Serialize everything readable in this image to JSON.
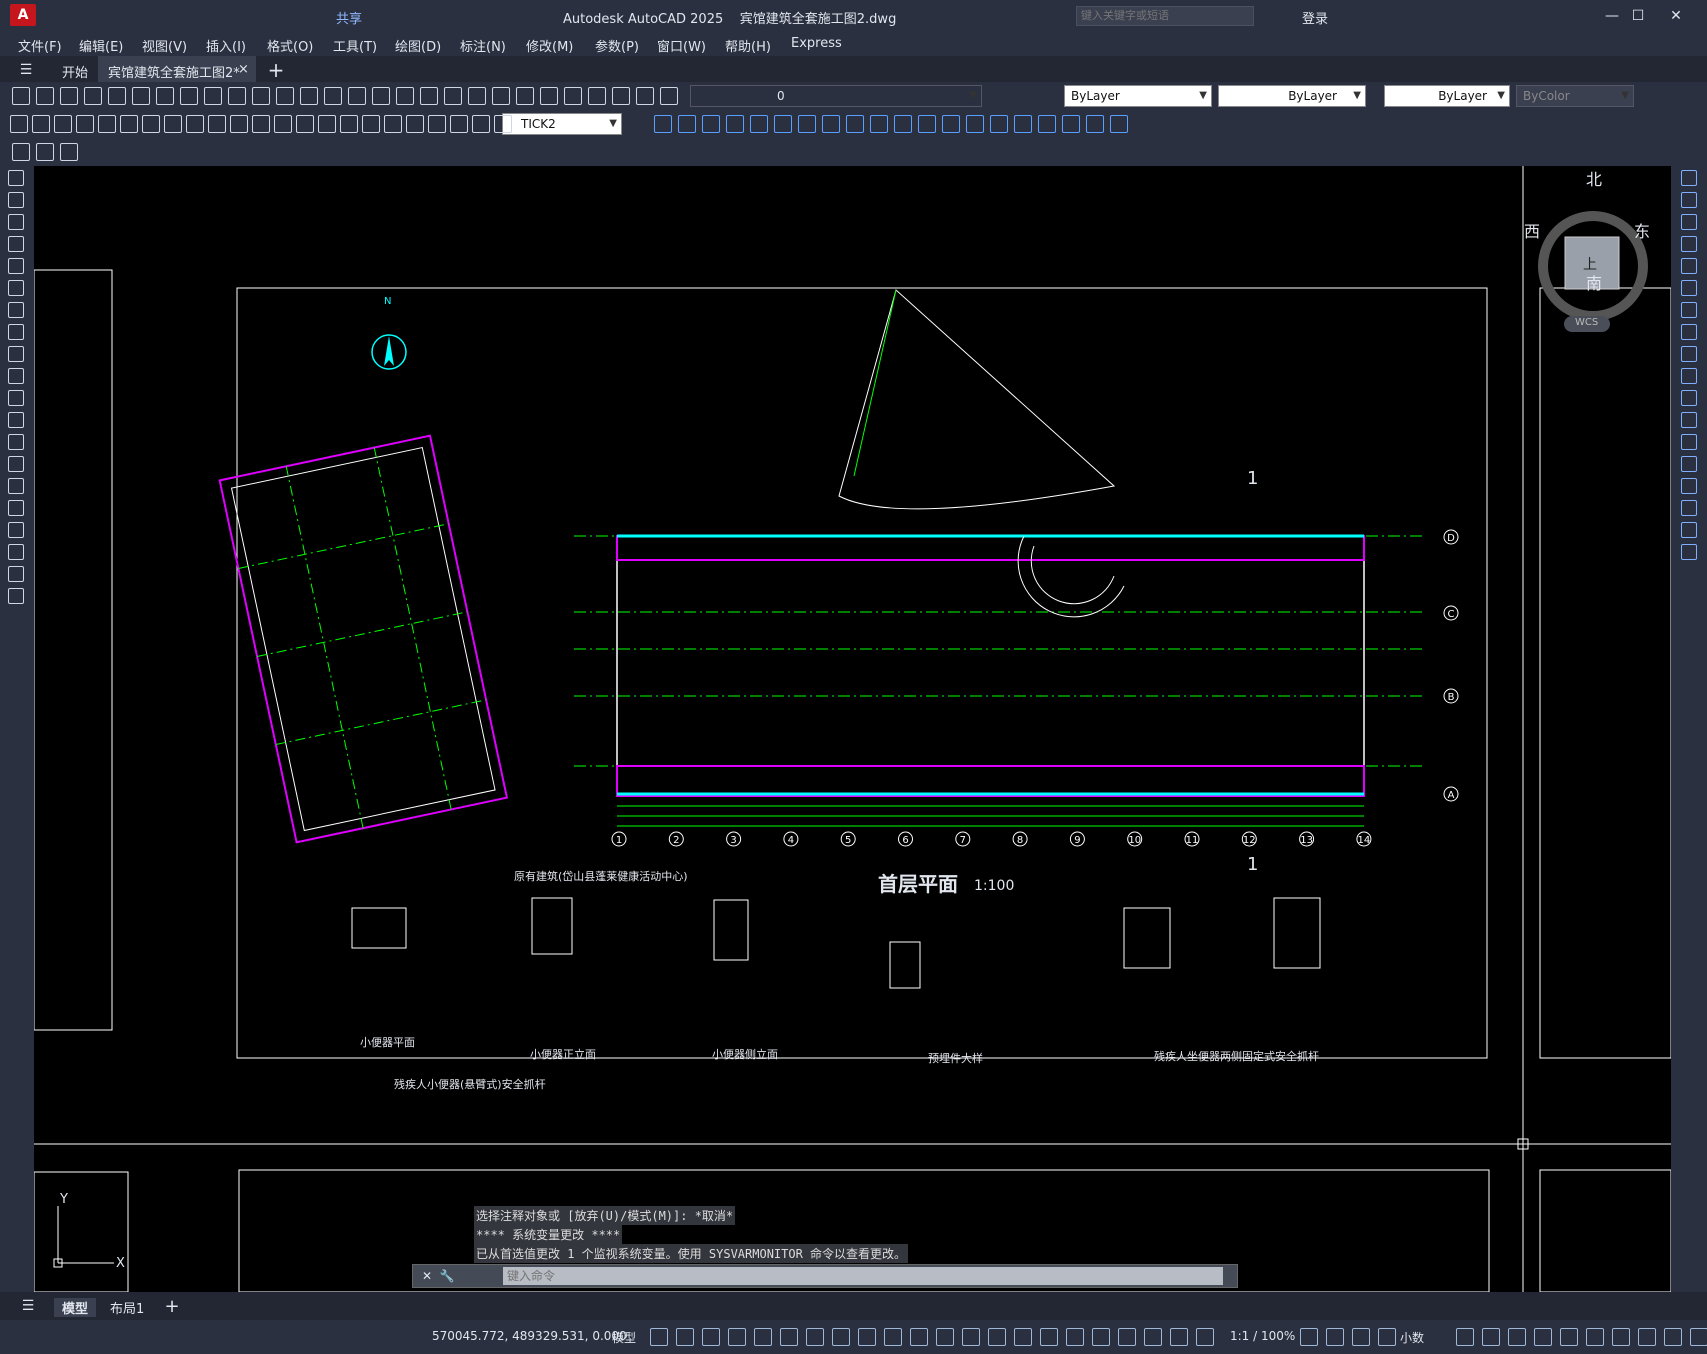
{
  "app": {
    "title": "Autodesk AutoCAD 2025",
    "file": "宾馆建筑全套施工图2.dwg",
    "share": "共享",
    "search_placeholder": "键入关键字或短语",
    "login": "登录"
  },
  "menu": [
    "文件(F)",
    "编辑(E)",
    "视图(V)",
    "插入(I)",
    "格式(O)",
    "工具(T)",
    "绘图(D)",
    "标注(N)",
    "修改(M)",
    "参数(P)",
    "窗口(W)",
    "帮助(H)",
    "Express"
  ],
  "tabs": {
    "start": "开始",
    "active": "宾馆建筑全套施工图2*"
  },
  "props": {
    "layer": "0",
    "color": "ByLayer",
    "linetype": "ByLayer",
    "lineweight": "ByLayer",
    "plotstyle": "ByColor",
    "dimstyle": "TICK2"
  },
  "viewcube": {
    "north": "北",
    "south": "南",
    "east": "东",
    "west": "西",
    "top": "上",
    "wcs": "WCS"
  },
  "drawing": {
    "plan_title": "首层平面",
    "scale": "1:100",
    "existing": "原有建筑(岱山县蓬莱健康活动中心)",
    "section": "1",
    "north": "N",
    "axes_x": [
      "1",
      "2",
      "3",
      "4",
      "5",
      "6",
      "7",
      "8",
      "9",
      "10",
      "11",
      "12",
      "13",
      "14"
    ],
    "axes_y": [
      "D",
      "C",
      "B",
      "A"
    ],
    "details": [
      "小便器平面",
      "小便器正立面",
      "小便器侧立面",
      "预埋件大样",
      "残疾人坐便器两侧固定式安全抓杆",
      "残疾人小便器(悬臂式)安全抓杆"
    ]
  },
  "command": {
    "lines": [
      "选择注释对象或 [放弃(U)/模式(M)]: *取消*",
      "**** 系统变量更改 ****",
      "已从首选值更改 1 个监视系统变量。使用 SYSVARMONITOR 命令以查看更改。"
    ],
    "placeholder": "键入命令"
  },
  "layouts": {
    "model": "模型",
    "layout1": "布局1"
  },
  "status": {
    "coords": "570045.772, 489329.531, 0.000",
    "model": "模型",
    "scale": "1:1 / 100%",
    "units": "小数"
  },
  "ucs": {
    "y": "Y",
    "x": "X"
  }
}
